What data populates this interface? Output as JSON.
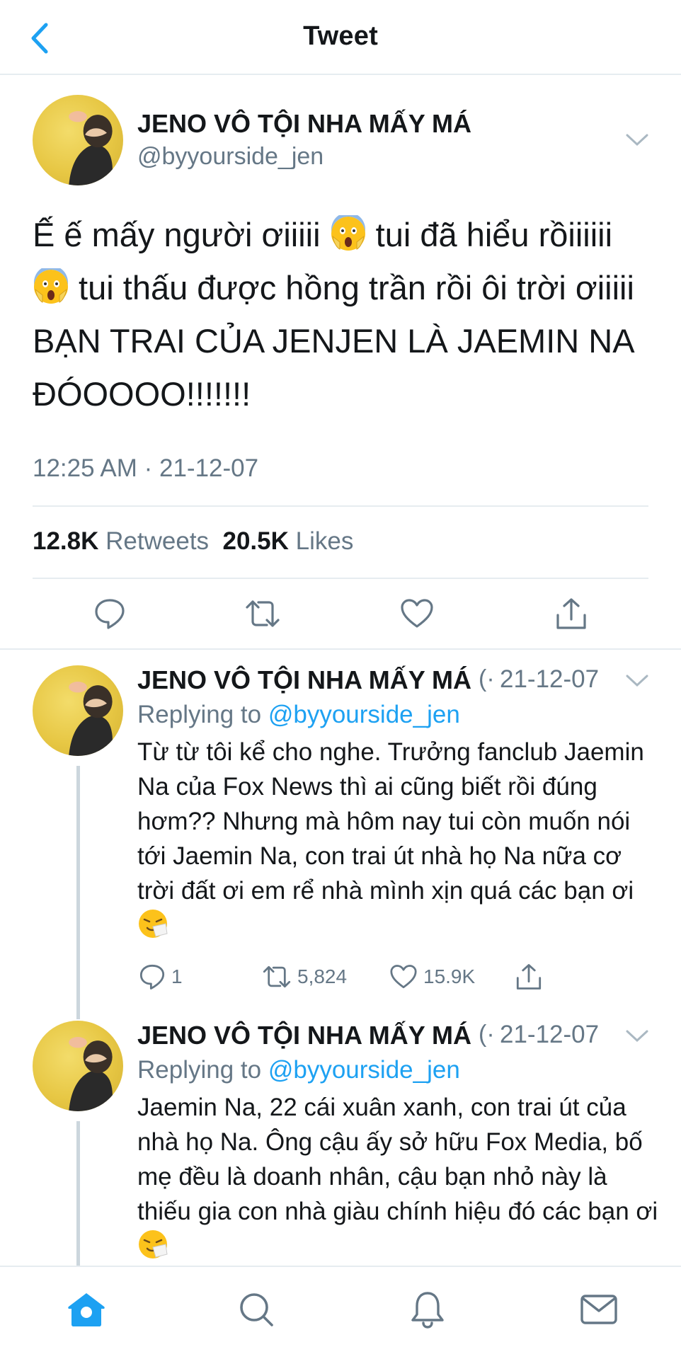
{
  "header": {
    "title": "Tweet",
    "back_icon": "chevron-left-icon"
  },
  "colors": {
    "accent": "#1da1f2",
    "secondary_text": "#657786",
    "divider": "#e6ecf0"
  },
  "main_tweet": {
    "display_name": "JENO VÔ TỘI NHA MẤY MÁ",
    "handle": "@byyourside_jen",
    "text_parts": [
      "Ế ế mấy người ơiiiii ",
      " tui đã hiểu rồiiiiii ",
      " tui thấu được hồng trần rồi ôi trời ơiiiii BẠN TRAI CỦA JENJEN LÀ JAEMIN NA ĐÓOOOO!!!!!!!"
    ],
    "timestamp": "12:25 AM · 21-12-07",
    "retweets_count": "12.8K",
    "retweets_label": "Retweets",
    "likes_count": "20.5K",
    "likes_label": "Likes"
  },
  "replies": [
    {
      "display_name": "JENO VÔ TỘI NHA MẤY MÁ",
      "date_sep": "(·",
      "date": "21-12-07",
      "replying_label": "Replying to",
      "replying_to": "@byyourside_jen",
      "text": "Từ từ tôi kể cho nghe. Trưởng fanclub Jaemin Na của Fox News thì ai cũng biết rồi đúng hơm?? Nhưng mà hôm nay tui còn muốn nói tới Jaemin Na, con trai út nhà họ Na nữa cơ trời đất ơi em rể nhà mình xịn quá các bạn ơi ",
      "reply_count": "1",
      "retweet_count": "5,824",
      "like_count": "15.9K"
    },
    {
      "display_name": "JENO VÔ TỘI NHA MẤY MÁ",
      "date_sep": "(·",
      "date": "21-12-07",
      "replying_label": "Replying to",
      "replying_to": "@byyourside_jen",
      "text": "Jaemin Na, 22 cái xuân xanh, con trai út của nhà họ Na. Ông cậu ấy sở hữu Fox Media, bố mẹ đều là doanh nhân, cậu bạn nhỏ này là thiếu gia con nhà giàu chính hiệu đó các bạn ơi "
    }
  ],
  "tabbar": {
    "icons": [
      "home-icon",
      "search-icon",
      "notifications-icon",
      "messages-icon"
    ]
  }
}
